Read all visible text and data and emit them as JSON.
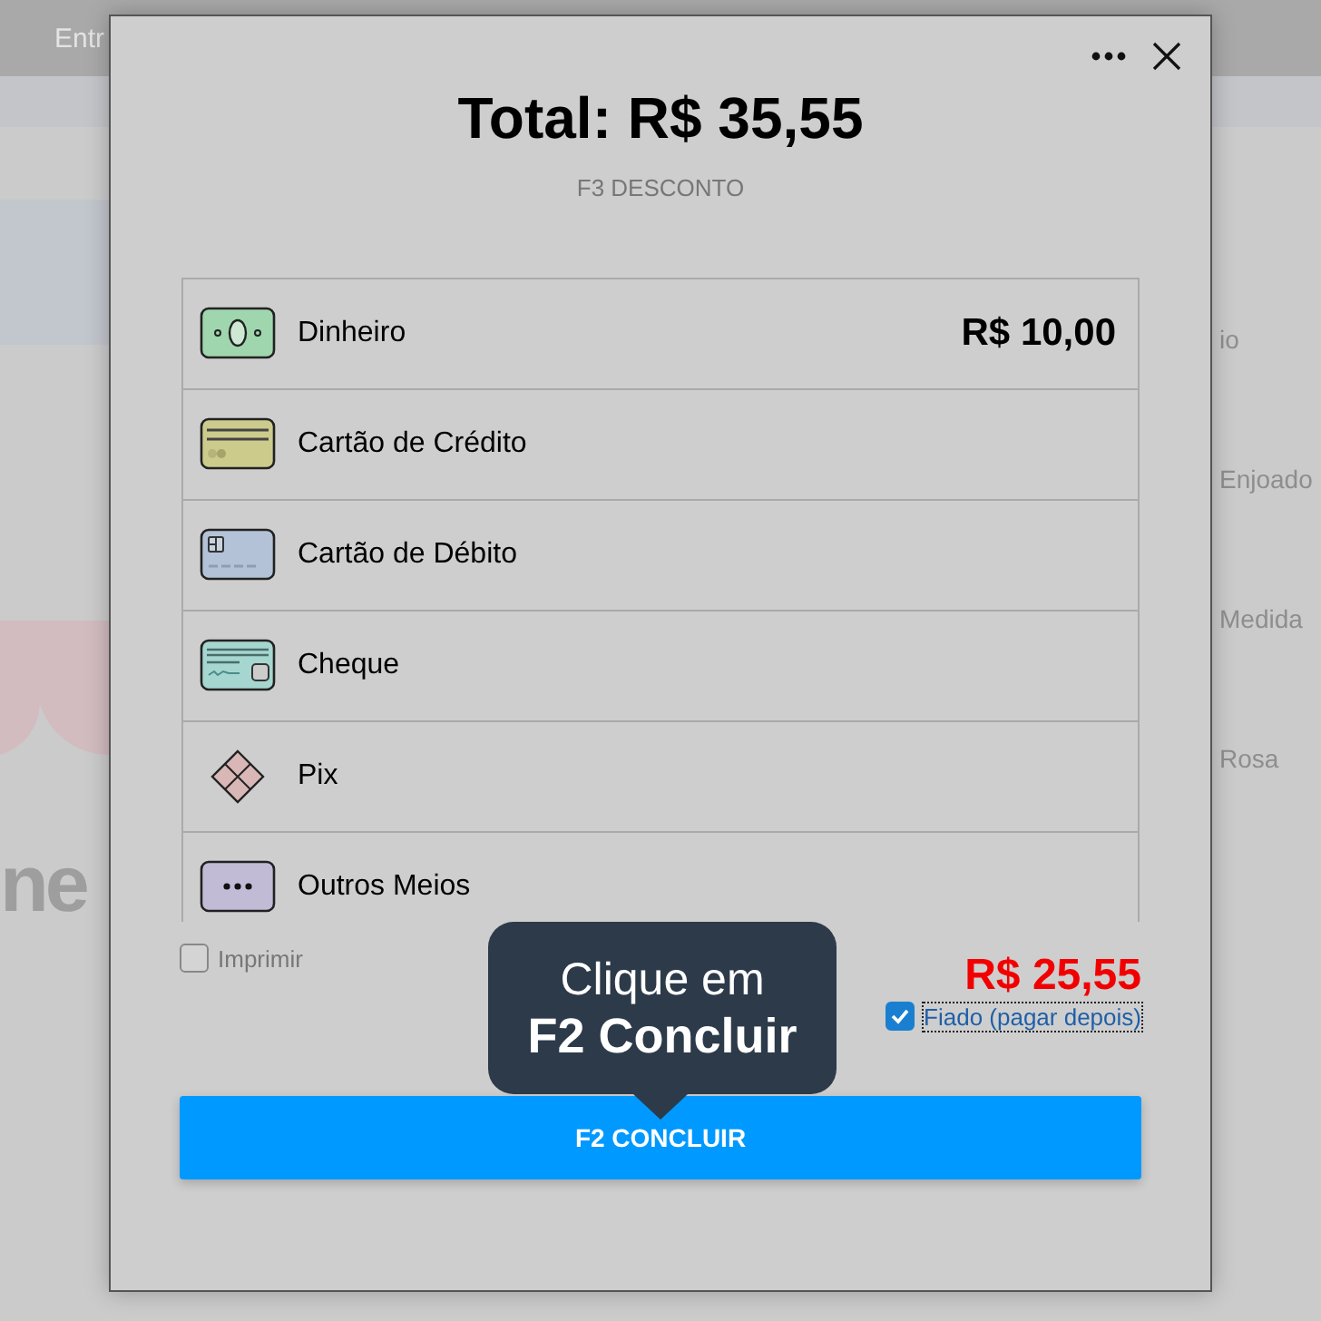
{
  "background": {
    "top_text": "Entr",
    "logo_text": "ne",
    "side_items": [
      "io",
      "Enjoado",
      "Medida",
      "Rosa"
    ]
  },
  "dialog": {
    "title": "Total: R$ 35,55",
    "discount_link": "F3 DESCONTO",
    "methods": [
      {
        "kind": "cash",
        "label": "Dinheiro",
        "amount": "R$ 10,00"
      },
      {
        "kind": "credit",
        "label": "Cartão de Crédito"
      },
      {
        "kind": "debit",
        "label": "Cartão de Débito"
      },
      {
        "kind": "cheque",
        "label": "Cheque"
      },
      {
        "kind": "pix",
        "label": "Pix"
      },
      {
        "kind": "other",
        "label": "Outros Meios"
      }
    ],
    "print": {
      "label": "Imprimir",
      "checked": false
    },
    "remaining": "R$ 25,55",
    "credit": {
      "label": "Fiado (pagar depois)",
      "checked": true
    },
    "tooltip": {
      "line1": "Clique em",
      "line2": "F2 Concluir"
    },
    "confirm_button": "F2 CONCLUIR"
  }
}
